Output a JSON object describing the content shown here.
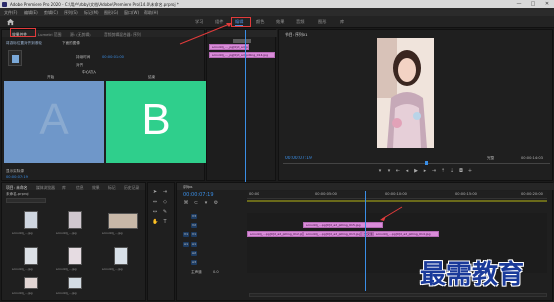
{
  "window": {
    "title": "Adobe Premiere Pro 2020 - C:\\用户\\rbby\\文档\\Adobe\\Premiere Pro\\14.0\\未命名.prproj *",
    "min": "—",
    "max": "□",
    "close": "✕"
  },
  "menu": [
    "文件(F)",
    "编辑(E)",
    "剪辑(C)",
    "序列(S)",
    "标记(M)",
    "图形(G)",
    "窗口(W)",
    "帮助(H)"
  ],
  "workspaces": {
    "items": [
      "学习",
      "组件",
      "编辑",
      "颜色",
      "效果",
      "音频",
      "图形",
      "库"
    ],
    "active_index": 2
  },
  "effect_controls": {
    "tabs": [
      "效果控件",
      "Lumetri 范围",
      "源: (无剪辑)",
      "音频剪辑混合器: 序列"
    ],
    "checkbox_label": "将游标位置对齐到滚轮",
    "sub_label": "下面的图像",
    "field_label_1": "持续时间",
    "field_value_1": "00:00:01:00",
    "field_label_2": "对齐",
    "field_value_2": "中心切入",
    "start_label": "开始",
    "end_label": "结束",
    "letter_a": "A",
    "letter_b": "B",
    "clip_a": "scnv4dj_..._pg[0]d_ad_pilling_012.jpg",
    "clip_b": "scnv4dj_..._pg[0]d_ad_pilling_014.jpg",
    "transition_name": "交叉溶解",
    "footer_label": "显示实际源",
    "footer_time": "00:00:07:19",
    "colors": {
      "a": "#6f97c9",
      "b": "#2fcf8c"
    }
  },
  "program_monitor": {
    "tab": "节目: 序列01",
    "timecode": "00:00:07:19",
    "fit": "完整",
    "duration": "00:00:14:03",
    "controls": [
      "mark-in-icon",
      "mark-out-icon",
      "go-in-icon",
      "step-back-icon",
      "play-icon",
      "step-forward-icon",
      "go-out-icon",
      "lift-icon",
      "extract-icon",
      "export-frame-icon",
      "add-icon"
    ]
  },
  "project_panel": {
    "tabs": [
      "项目: 未命名",
      "媒体浏览器",
      "库",
      "信息",
      "效果",
      "标记",
      "历史记录"
    ],
    "path": "未命名.prproj",
    "items": [
      {
        "name": "scnv4dj_...jpg",
        "dur": "5:00"
      },
      {
        "name": "scnv4dj_...jpg",
        "dur": "5:00"
      },
      {
        "name": "scnv4dj_...jpg",
        "dur": "5:00"
      },
      {
        "name": "scnv4dj_...jpg",
        "dur": "5:00"
      },
      {
        "name": "scnv4dj_...jpg",
        "dur": "5:00"
      },
      {
        "name": "scnv4dj_...jpg",
        "dur": "5:00"
      },
      {
        "name": "scnv4dj_...jpg",
        "dur": "5:00"
      },
      {
        "name": "scnv4dj_...jpg",
        "dur": "5:00"
      }
    ]
  },
  "timeline": {
    "tab": "序列01",
    "timecode": "00:00:07:19",
    "ruler": [
      "00:00",
      "00:00:05:00",
      "00:00:10:00",
      "00:00:15:00",
      "00:00:20:00"
    ],
    "tracks": [
      "V3",
      "V2",
      "V1",
      "A1",
      "A2",
      "A3"
    ],
    "master": "主声道",
    "master_value": "0.0",
    "clips_v1": [
      "scnv4dj_...pg[0]d_ad_pilling_012.jpg",
      "scnv4dj_...pg[0]d_ad_pilling_013.jpg",
      "交叉溶解",
      "scnv4dj_...pg[0]d_ad_pilling_014.jpg"
    ],
    "clips_v2": [
      "scnv4dj_...pg[0]d_ad_pilling_015.jpg"
    ]
  },
  "watermark": {
    "text": "最需教育"
  }
}
